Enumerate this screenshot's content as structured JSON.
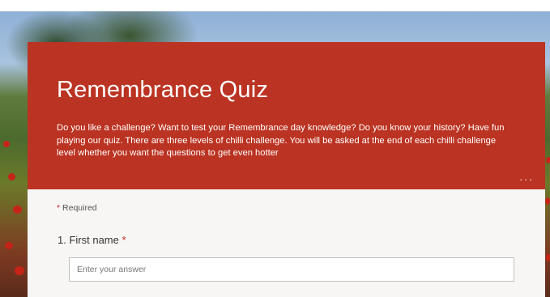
{
  "form": {
    "title": "Remembrance Quiz",
    "description": "Do you like a challenge? Want to test your Remembrance day knowledge? Do you know your history? Have fun playing our quiz. There are three levels of chilli challenge. You will be asked at the end of each chilli challenge level whether you want the questions to get even hotter",
    "more_label": "...",
    "required_marker": "*",
    "required_label": "Required"
  },
  "questions": [
    {
      "number": "1.",
      "label": "First name",
      "required_marker": "*",
      "placeholder": "Enter your answer",
      "value": ""
    }
  ],
  "colors": {
    "header_bg": "#bb3322",
    "body_bg": "#f7f6f5",
    "required": "#c42b1c"
  }
}
